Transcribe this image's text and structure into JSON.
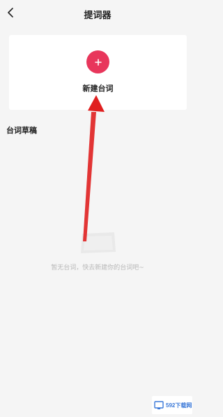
{
  "header": {
    "back_icon": "chevron-left-icon",
    "title": "提词器"
  },
  "new_card": {
    "icon": "plus-icon",
    "label": "新建台词",
    "accent_color": "#e8365b"
  },
  "drafts": {
    "title": "台词草稿",
    "empty_text": "暂无台词，快去新建你的台词吧~"
  },
  "annotation": {
    "arrow_color": "#e02020"
  },
  "watermark": {
    "text": "592下载网"
  }
}
